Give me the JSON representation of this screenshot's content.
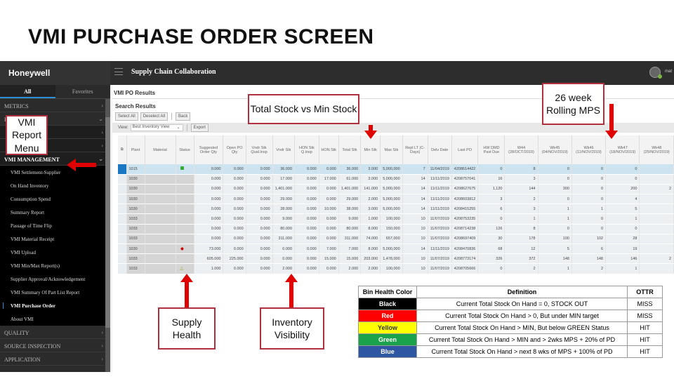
{
  "slide_title": "VMI PURCHASE ORDER SCREEN",
  "sidebar": {
    "brand": "Honeywell",
    "tabs": [
      {
        "label": "All",
        "active": true
      },
      {
        "label": "Favorites",
        "active": false
      }
    ],
    "groups_top": [
      {
        "label": "METRICS",
        "chevron": "›"
      },
      {
        "label": "R",
        "chevron": "⌄"
      }
    ],
    "hidden_items": [
      {
        "chevron": "›"
      },
      {
        "chevron": "›"
      }
    ],
    "vmi_group": {
      "label": "VMI MANAGEMENT",
      "chevron": "⌄"
    },
    "items": [
      {
        "label": "VMI Settlement-Supplier"
      },
      {
        "label": "On Hand Inventory"
      },
      {
        "label": "Consumption Spend"
      },
      {
        "label": "Summary Report"
      },
      {
        "label": "Passage of Time Flip"
      },
      {
        "label": "VMI Material Receipt"
      },
      {
        "label": "VMI Upload"
      },
      {
        "label": "VMI Min/Max Report(s)"
      },
      {
        "label": "Supplier Approval/Acknowledgement"
      },
      {
        "label": "VMI Summary Of Part List Report"
      },
      {
        "label": "VMI Purchase Order",
        "active": true
      },
      {
        "label": "About VMI"
      }
    ],
    "groups_bottom": [
      {
        "label": "QUALITY",
        "chevron": "›"
      },
      {
        "label": "SOURCE INSPECTION",
        "chevron": "›"
      },
      {
        "label": "APPLICATION",
        "chevron": "›"
      }
    ]
  },
  "topbar": {
    "title": "Supply Chain Collaboration",
    "user": "mat"
  },
  "content": {
    "page_title": "VMI PO Results",
    "section_title": "Search Results",
    "buttons": {
      "select_all": "Select All",
      "deselect_all": "Deselect All",
      "back": "Back"
    },
    "view_label": "View:",
    "view_value": "Best Inventory View",
    "export_label": "Export"
  },
  "table": {
    "columns": [
      "Plant",
      "Material",
      "Status",
      "Suggested Order Qty",
      "Open PO Qty",
      "Vndr Stk Qual.Insp",
      "Vndr Stk",
      "HON Stk Q.insp",
      "HON Stk",
      "Total Stk",
      "Min Stk",
      "Max Stk",
      "Repl LT (C-Days)",
      "Delv Date",
      "Last PO",
      "HW DMD Past Due",
      "W44 (28/OCT/2019)",
      "Wk45 (04/NOV/2019)",
      "Wk46 (11/NOV/2019)",
      "Wk47 (18/NOV/2019)",
      "Wk48 (25/NOV/2019)"
    ],
    "rows": [
      {
        "selected": true,
        "plant": "1015",
        "material": "",
        "status": "green",
        "cells": [
          "0.000",
          "0.000",
          "0.000",
          "36.000",
          "0.000",
          "0.000",
          "36.000",
          "3.000",
          "5,000,000",
          "7",
          "11/04/2019",
          "4208614422",
          "0",
          "8",
          "0",
          "0",
          "0",
          ""
        ]
      },
      {
        "plant": "1030",
        "material": "",
        "status": "",
        "cells": [
          "0.000",
          "0.000",
          "0.000",
          "17.000",
          "0.000",
          "17.000",
          "61.000",
          "3.000",
          "5,000,000",
          "14",
          "11/11/2019",
          "4208757041",
          "16",
          "3",
          "0",
          "0",
          "0",
          ""
        ]
      },
      {
        "plant": "1030",
        "material": "",
        "status": "",
        "cells": [
          "0.000",
          "0.000",
          "0.000",
          "1,401.000",
          "0.000",
          "0.000",
          "1,401.000",
          "141.000",
          "5,000,000",
          "14",
          "11/11/2019",
          "4208627675",
          "1,120",
          "144",
          "300",
          "0",
          "200",
          "2"
        ]
      },
      {
        "plant": "1030",
        "material": "",
        "status": "",
        "cells": [
          "0.000",
          "0.000",
          "0.000",
          "29.000",
          "0.000",
          "0.000",
          "29.000",
          "2.000",
          "5,000,000",
          "14",
          "11/11/2019",
          "4208603812",
          "3",
          "2",
          "0",
          "0",
          "4",
          ""
        ]
      },
      {
        "plant": "1030",
        "material": "",
        "status": "",
        "cells": [
          "0.000",
          "0.000",
          "0.000",
          "28.000",
          "0.000",
          "10.000",
          "38.000",
          "3.000",
          "5,000,000",
          "14",
          "11/11/2019",
          "4208415255",
          "6",
          "3",
          "1",
          "1",
          "5",
          ""
        ]
      },
      {
        "plant": "1033",
        "material": "",
        "status": "",
        "cells": [
          "0.000",
          "0.000",
          "0.000",
          "9.000",
          "0.000",
          "0.000",
          "9.000",
          "1.000",
          "100,000",
          "10",
          "11/07/2019",
          "4208753235",
          "0",
          "1",
          "1",
          "0",
          "1",
          ""
        ]
      },
      {
        "plant": "1033",
        "material": "",
        "status": "",
        "cells": [
          "0.000",
          "0.000",
          "0.000",
          "80.000",
          "0.000",
          "0.000",
          "80.000",
          "8.000",
          "150,000",
          "10",
          "11/07/2019",
          "4208714238",
          "126",
          "8",
          "0",
          "0",
          "0",
          ""
        ]
      },
      {
        "plant": "1033",
        "material": "",
        "status": "",
        "cells": [
          "0.000",
          "0.000",
          "0.000",
          "311.000",
          "0.000",
          "0.000",
          "311.000",
          "74.000",
          "657,000",
          "10",
          "11/07/2019",
          "4208697409",
          "30",
          "178",
          "100",
          "102",
          "28",
          ""
        ]
      },
      {
        "plant": "1030",
        "material": "",
        "status": "red",
        "cells": [
          "73.000",
          "0.000",
          "0.000",
          "0.000",
          "0.000",
          "7.000",
          "7.000",
          "8.000",
          "5,000,000",
          "14",
          "11/11/2019",
          "4208470836",
          "68",
          "12",
          "5",
          "6",
          "19",
          ""
        ]
      },
      {
        "plant": "1033",
        "material": "",
        "status": "",
        "cells": [
          "605.000",
          "225.000",
          "0.000",
          "0.000",
          "0.000",
          "15.000",
          "15.000",
          "203.000",
          "1,478,000",
          "10",
          "11/07/2019",
          "4208773174",
          "326",
          "372",
          "148",
          "148",
          "146",
          "2"
        ]
      },
      {
        "plant": "1033",
        "material": "",
        "status": "yellow",
        "cells": [
          "1.000",
          "0.000",
          "0.000",
          "2.000",
          "0.000",
          "0.000",
          "2.000",
          "2.000",
          "100,000",
          "10",
          "11/07/2019",
          "4208705666",
          "0",
          "2",
          "1",
          "2",
          "1",
          ""
        ]
      }
    ]
  },
  "callouts": {
    "vmi_menu": "VMI Report Menu",
    "total_vs_min": "Total Stock vs Min Stock",
    "rolling_mps": "26 week Rolling MPS",
    "supply_health": "Supply Health",
    "inventory_visibility": "Inventory Visibility"
  },
  "legend": {
    "headers": [
      "Bin Health Color",
      "Definition",
      "OTTR"
    ],
    "rows": [
      {
        "color_name": "Black",
        "bg": "#000000",
        "fg": "#ffffff",
        "definition": "Current Total Stock On Hand = 0, STOCK OUT",
        "ottr": "MISS"
      },
      {
        "color_name": "Red",
        "bg": "#ff0000",
        "fg": "#ffffff",
        "definition": "Current Total Stock On Hand > 0,  But under MIN target",
        "ottr": "MISS"
      },
      {
        "color_name": "Yellow",
        "bg": "#ffff00",
        "fg": "#333333",
        "definition": "Current Total Stock On Hand > MIN, But below GREEN Status",
        "ottr": "HIT"
      },
      {
        "color_name": "Green",
        "bg": "#1aa34a",
        "fg": "#ffffff",
        "definition": "Current Total Stock On Hand > MIN and > 2wks MPS + 20% of PD",
        "ottr": "HIT"
      },
      {
        "color_name": "Blue",
        "bg": "#2f56a3",
        "fg": "#ffffff",
        "definition": "Current Total Stock On Hand > next 8 wks of MPS + 100% of PD",
        "ottr": "HIT"
      }
    ]
  },
  "colors": {
    "callout_border": "#b03040",
    "arrow": "#e00000",
    "selection": "#1a78c2"
  }
}
